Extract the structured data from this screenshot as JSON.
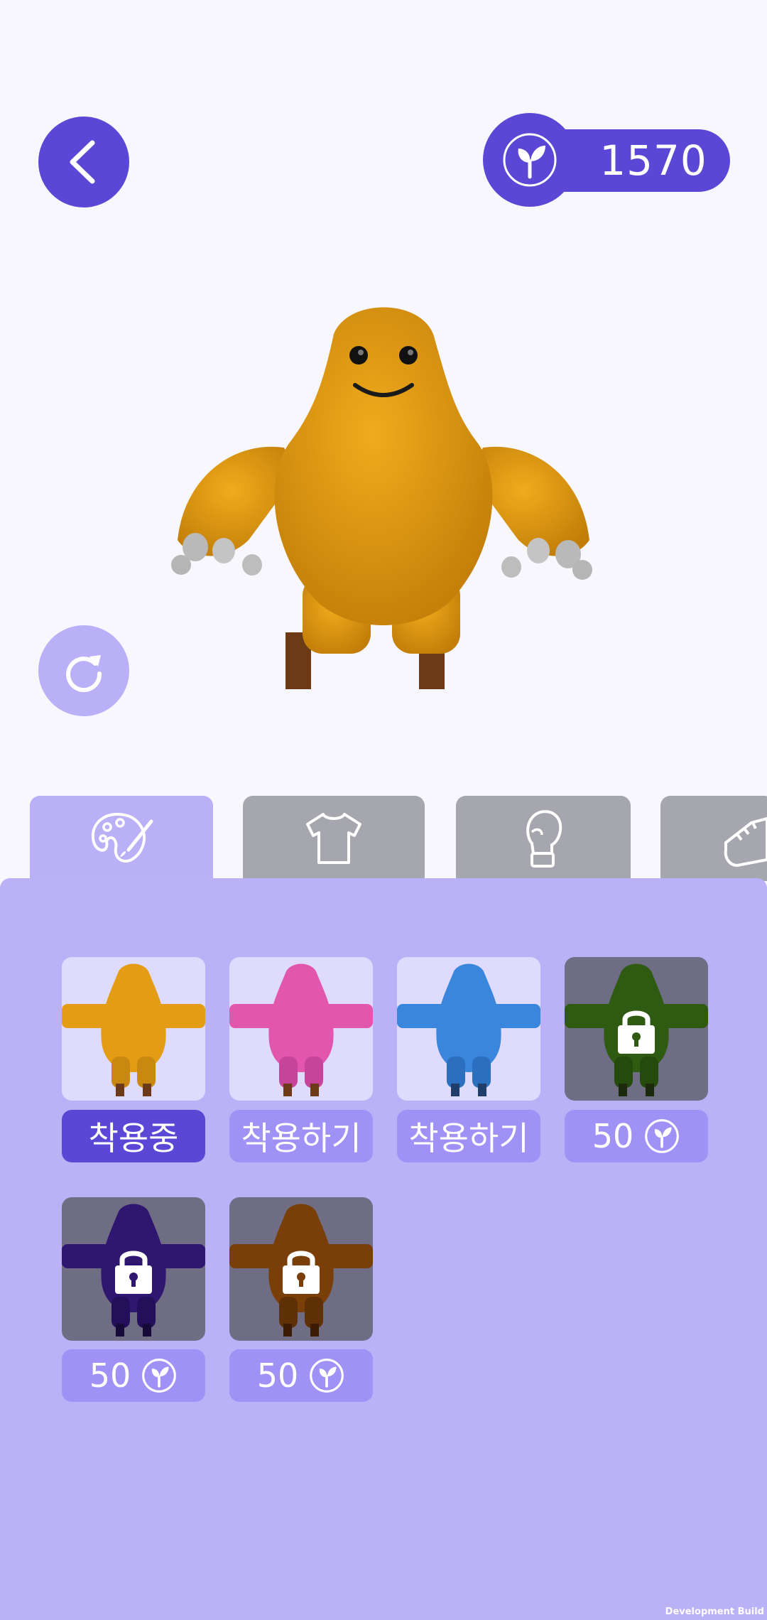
{
  "currency": {
    "amount": "1570",
    "icon": "sprout-icon"
  },
  "navigation": {
    "back_icon": "chevron-left-icon",
    "reset_icon": "refresh-icon"
  },
  "tabs": [
    {
      "icon": "palette-icon",
      "active": true
    },
    {
      "icon": "tshirt-icon",
      "active": false
    },
    {
      "icon": "boxing-glove-icon",
      "active": false
    },
    {
      "icon": "shoe-icon",
      "active": false
    }
  ],
  "character": {
    "color": "#e09a12"
  },
  "skins": [
    {
      "color": "#e39c14",
      "status": "equipped",
      "label": "착용중",
      "locked": false
    },
    {
      "color": "#e256ae",
      "status": "owned",
      "label": "착용하기",
      "locked": false
    },
    {
      "color": "#3a86dc",
      "status": "owned",
      "label": "착용하기",
      "locked": false
    },
    {
      "color": "#2f5a12",
      "status": "locked",
      "price": "50",
      "locked": true
    },
    {
      "color": "#2f1670",
      "status": "locked",
      "price": "50",
      "locked": true
    },
    {
      "color": "#7a3e08",
      "status": "locked",
      "price": "50",
      "locked": true
    }
  ],
  "footer": {
    "build_label": "Development Build"
  },
  "theme": {
    "primary": "#5b47d6",
    "panel": "#bab1f7",
    "tab_inactive": "#a6a6ae"
  }
}
